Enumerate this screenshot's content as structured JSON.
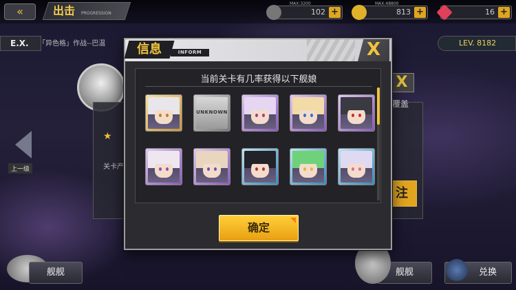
{
  "colors": {
    "accent": "#f0c43e",
    "dialog_bg": "#2b2b30",
    "confirm": "#f2b52a"
  },
  "topbar": {
    "back_icon": "double-left-arrow-icon",
    "title": "出击",
    "subtitle": "PROGRESSION",
    "resources": [
      {
        "icon": "oil-icon",
        "max": "MAX:3200",
        "value": "102"
      },
      {
        "icon": "coin-icon",
        "max": "MAX:48800",
        "value": "813"
      },
      {
        "icon": "gem-icon",
        "max": "",
        "value": "16"
      }
    ]
  },
  "background": {
    "stage_tag": "E.X.",
    "op_name": "「异色格」作战--巴温",
    "level_tag": "LEV. 8182",
    "prev_label": "上一级",
    "panel_text": "覆盖",
    "panel_star": "★",
    "panel_drop": "关卡产",
    "panel_go": "注",
    "bottom_left": "舰舰",
    "bottom_mid": "舰舰",
    "bottom_right": "兑换"
  },
  "dialog": {
    "title": "信息",
    "inform": "INFORM",
    "close_label": "X",
    "message": "当前关卡有几率获得以下舰娘",
    "confirm_label": "确定",
    "cards": [
      {
        "name": "shipgirl-1",
        "rarity": "gold",
        "hair": "#e8e6ea",
        "eye": "#c4801a",
        "unknown": false
      },
      {
        "name": "unknown",
        "rarity": "gray",
        "unknown": true,
        "label": "UNKNOWN"
      },
      {
        "name": "shipgirl-3",
        "rarity": "purple",
        "hair": "#e6d6f2",
        "eye": "#b0357a",
        "unknown": false
      },
      {
        "name": "shipgirl-4",
        "rarity": "purple",
        "hair": "#f2dba6",
        "eye": "#3a6bc4",
        "unknown": false
      },
      {
        "name": "shipgirl-5",
        "rarity": "purple",
        "hair": "#3a3a42",
        "eye": "#c42d2d",
        "unknown": false
      },
      {
        "name": "shipgirl-6",
        "rarity": "purple",
        "hair": "#efe7f0",
        "eye": "#8a4fb0",
        "unknown": false
      },
      {
        "name": "shipgirl-7",
        "rarity": "purple",
        "hair": "#e8d7be",
        "eye": "#6e4fb0",
        "unknown": false
      },
      {
        "name": "shipgirl-8",
        "rarity": "blue",
        "hair": "#232228",
        "eye": "#a83232",
        "unknown": false
      },
      {
        "name": "shipgirl-9",
        "rarity": "blue",
        "hair": "#6fd27a",
        "eye": "#e3b33b",
        "unknown": false
      },
      {
        "name": "shipgirl-10",
        "rarity": "blue",
        "hair": "#dfd9f2",
        "eye": "#d86aa4",
        "unknown": false
      }
    ]
  }
}
